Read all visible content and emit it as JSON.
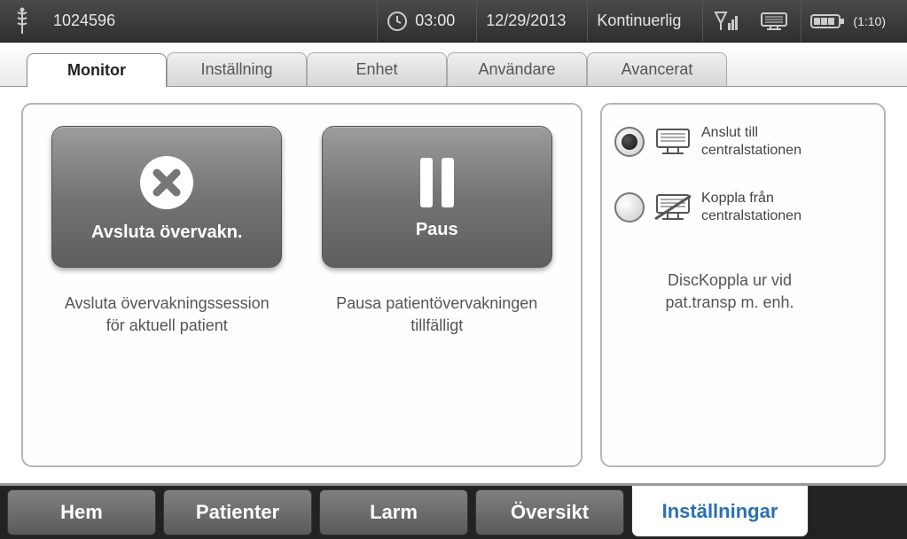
{
  "status": {
    "patient_id": "1024596",
    "time": "03:00",
    "date": "12/29/2013",
    "mode": "Kontinuerlig",
    "battery_label": "(1:10)"
  },
  "tabs": {
    "monitor": "Monitor",
    "installning": "Inställning",
    "enhet": "Enhet",
    "anvandare": "Användare",
    "avancerat": "Avancerat"
  },
  "monitor_panel": {
    "end_btn": "Avsluta övervakn.",
    "end_desc_l1": "Avsluta övervakningssession",
    "end_desc_l2": "för aktuell patient",
    "pause_btn": "Paus",
    "pause_desc_l1": "Pausa patientövervakningen",
    "pause_desc_l2": "tillfälligt"
  },
  "central": {
    "connect_l1": "Anslut till",
    "connect_l2": "centralstationen",
    "disconnect_l1": "Koppla från",
    "disconnect_l2": "centralstationen",
    "note_l1": "DiscKoppla ur vid",
    "note_l2": "pat.transp m. enh."
  },
  "nav": {
    "hem": "Hem",
    "patienter": "Patienter",
    "larm": "Larm",
    "oversikt": "Översikt",
    "installningar": "Inställningar"
  }
}
